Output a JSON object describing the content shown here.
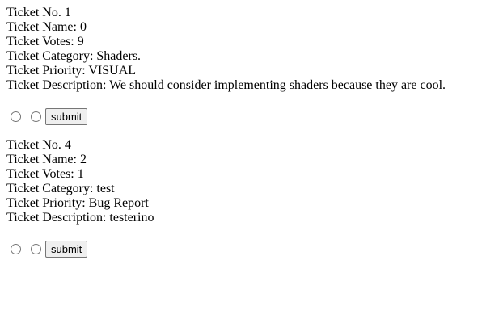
{
  "tickets": [
    {
      "number_line": "Ticket No. 1",
      "name_line": "Ticket Name: 0",
      "votes_line": "Ticket Votes: 9",
      "category_line": "Ticket Category: Shaders.",
      "priority_line": "Ticket Priority: VISUAL",
      "description_line": "Ticket Description: We should consider implementing shaders because they are cool.",
      "submit_label": "submit"
    },
    {
      "number_line": "Ticket No. 4",
      "name_line": "Ticket Name: 2",
      "votes_line": "Ticket Votes: 1",
      "category_line": "Ticket Category: test",
      "priority_line": "Ticket Priority: Bug Report",
      "description_line": "Ticket Description: testerino",
      "submit_label": "submit"
    }
  ]
}
